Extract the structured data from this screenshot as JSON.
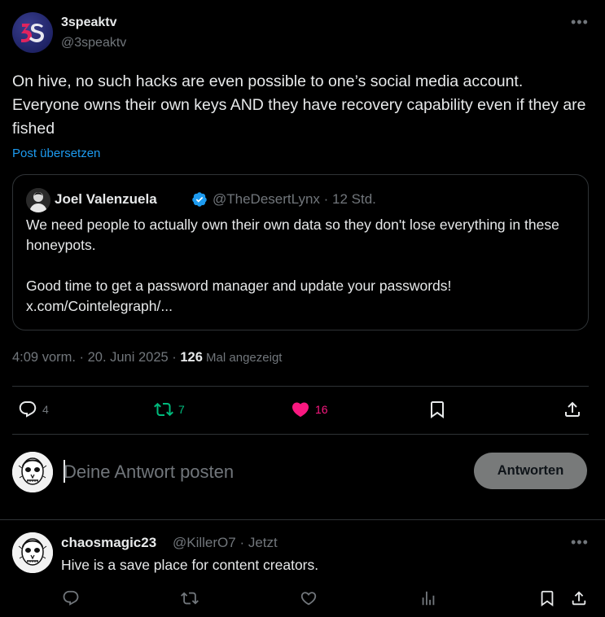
{
  "tweet": {
    "display_name": "3speaktv",
    "handle": "@3speaktv",
    "text": "On hive, no such hacks are even possible to one’s social media account. Everyone owns their own keys AND they have recovery capability even if they are fished",
    "translate_label": "Post übersetzen",
    "avatar_icon": "3s-logo-icon"
  },
  "quote": {
    "name": "Joel Valenzuela",
    "handle_time": "@TheDesertLynx · 12 Std.",
    "body_line1": "We need people to actually own their own data so they don't lose everything in these honeypots.",
    "body_line2": "Good time to get a password manager and update your passwords!",
    "link": "x.com/Cointelegraph/..."
  },
  "meta": {
    "time_date": "4:09 vorm. · 20. Juni 2025 · ",
    "views": "126",
    "views_label": " Mal angezeigt"
  },
  "actions": {
    "replies": "4",
    "reposts": "7",
    "likes": "16",
    "colors": {
      "repost": "#00ba7c",
      "like": "#f91880",
      "muted": "#71767b"
    }
  },
  "composer": {
    "placeholder": "Deine Antwort posten",
    "button_label": "Antworten"
  },
  "reply": {
    "name": "chaosmagic23",
    "handle_time": "@KillerO7 · Jetzt",
    "text": "Hive is a save place for content creators."
  }
}
